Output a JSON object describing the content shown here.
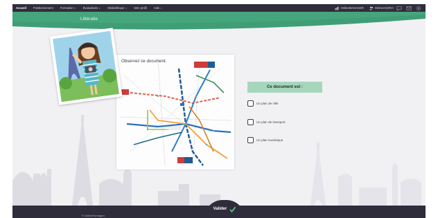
{
  "nav": {
    "items": [
      {
        "label": "Accueil",
        "active": true
      },
      {
        "label": "Positionnement",
        "active": false
      },
      {
        "label": "Formation",
        "active": false,
        "dropdown": true
      },
      {
        "label": "Évaluations",
        "active": false,
        "dropdown": true
      },
      {
        "label": "Médiathèque",
        "active": false,
        "dropdown": true
      },
      {
        "label": "Mon profil",
        "active": false
      },
      {
        "label": "Aide",
        "active": false,
        "dropdown": true
      }
    ],
    "account1": "OnlineMANAGER",
    "account2": "OnlineAGORA",
    "icons": [
      "chat-icon",
      "mail-icon",
      "settings-icon"
    ]
  },
  "banner": {
    "title": "Littératie"
  },
  "document": {
    "caption": "Observez ce document."
  },
  "question": {
    "title": "Ce document est :"
  },
  "options": [
    "Un plan de ville",
    "Un plan de transport",
    "Un plan touristique"
  ],
  "footer": {
    "validate_label": "Valider",
    "copyright": "© OnlineFormapro"
  },
  "colors": {
    "nav": "#2f2d3b",
    "banner": "#3f9e76",
    "accent": "#a6d7bd",
    "check": "#5ec28a"
  }
}
